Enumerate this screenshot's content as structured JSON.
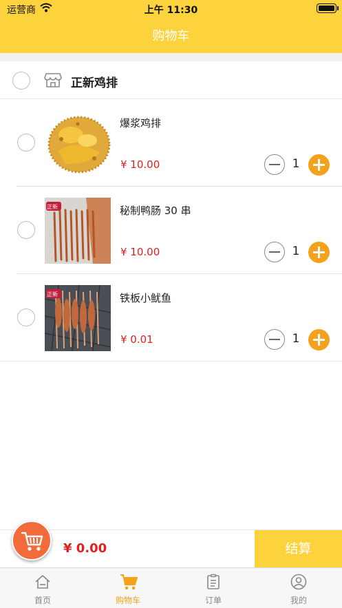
{
  "status_bar": {
    "carrier": "运营商",
    "time": "上午 11:30"
  },
  "nav": {
    "title": "购物车"
  },
  "shop": {
    "name": "正新鸡排",
    "icon": "store-icon"
  },
  "items": [
    {
      "name": "爆浆鸡排",
      "price": "¥ 10.00",
      "quantity": "1"
    },
    {
      "name": "秘制鸭肠 30 串",
      "price": "¥ 10.00",
      "quantity": "1",
      "badge": "正新"
    },
    {
      "name": "铁板小鱿鱼",
      "price": "¥ 0.01",
      "quantity": "1",
      "badge": "正新"
    }
  ],
  "checkout": {
    "total": "¥ 0.00",
    "settle_label": "结算"
  },
  "tabs": [
    {
      "label": "首页",
      "icon": "home-icon",
      "active": false
    },
    {
      "label": "购物车",
      "icon": "cart-icon",
      "active": true
    },
    {
      "label": "订单",
      "icon": "order-icon",
      "active": false
    },
    {
      "label": "我的",
      "icon": "profile-icon",
      "active": false
    }
  ],
  "colors": {
    "brand_yellow": "#fcd33d",
    "accent_orange": "#f4a21c",
    "price_red": "#e02020",
    "cart_badge": "#f26b3a"
  }
}
